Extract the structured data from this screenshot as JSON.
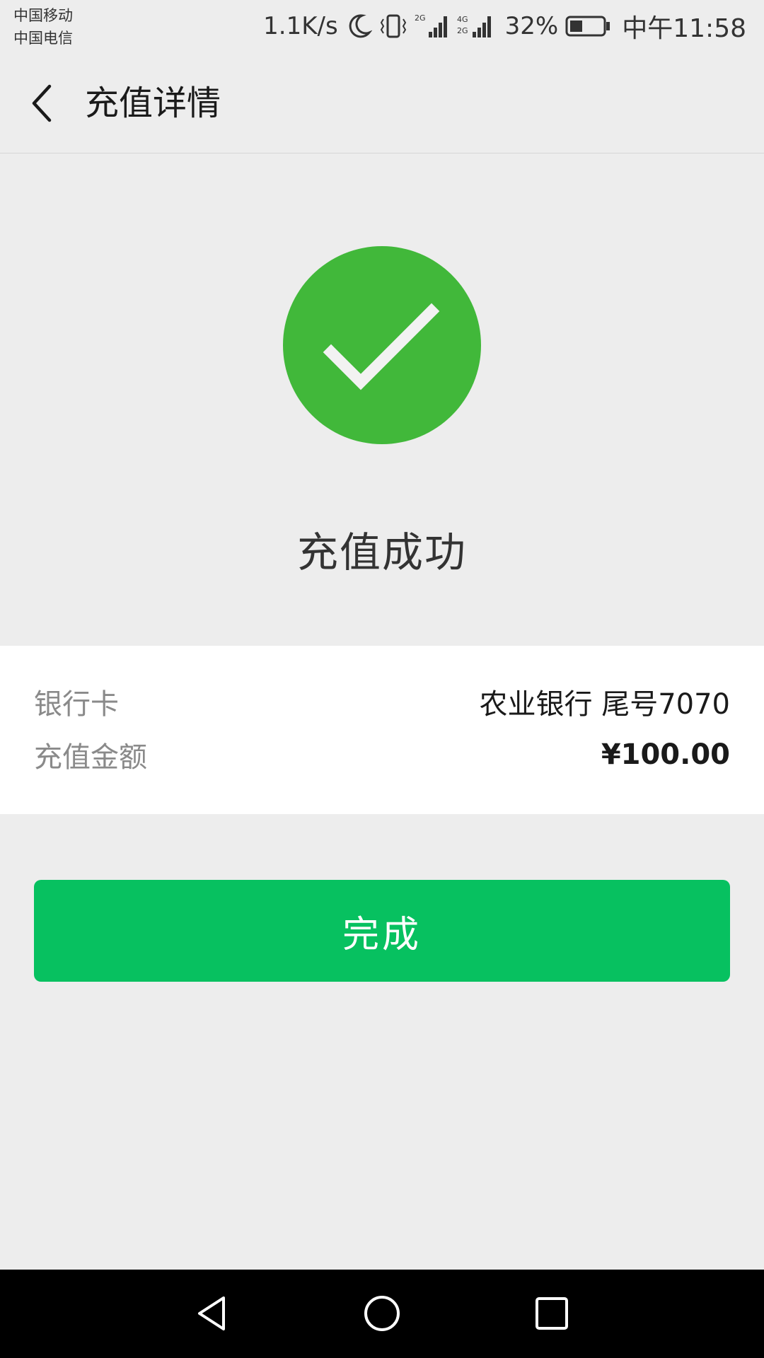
{
  "status_bar": {
    "carrier_1": "中国移动",
    "carrier_2": "中国电信",
    "net_speed": "1.1K/s",
    "battery_percent": "32%",
    "time": "中午11:58",
    "icons": [
      "moon-icon",
      "vibrate-icon",
      "signal-2g-icon",
      "signal-4g-icon",
      "battery-icon"
    ]
  },
  "header": {
    "back_icon": "back-arrow-icon",
    "title": "充值详情"
  },
  "result": {
    "icon": "success-check-icon",
    "message": "充值成功",
    "icon_color": "#41b83a"
  },
  "details": {
    "bank_card_label": "银行卡",
    "bank_card_value": "农业银行 尾号7070",
    "amount_label": "充值金额",
    "amount_value": "¥100.00"
  },
  "actions": {
    "done_label": "完成",
    "done_color": "#07c160"
  },
  "nav_bar": {
    "buttons": [
      "back-triangle-icon",
      "home-circle-icon",
      "recent-square-icon"
    ]
  }
}
